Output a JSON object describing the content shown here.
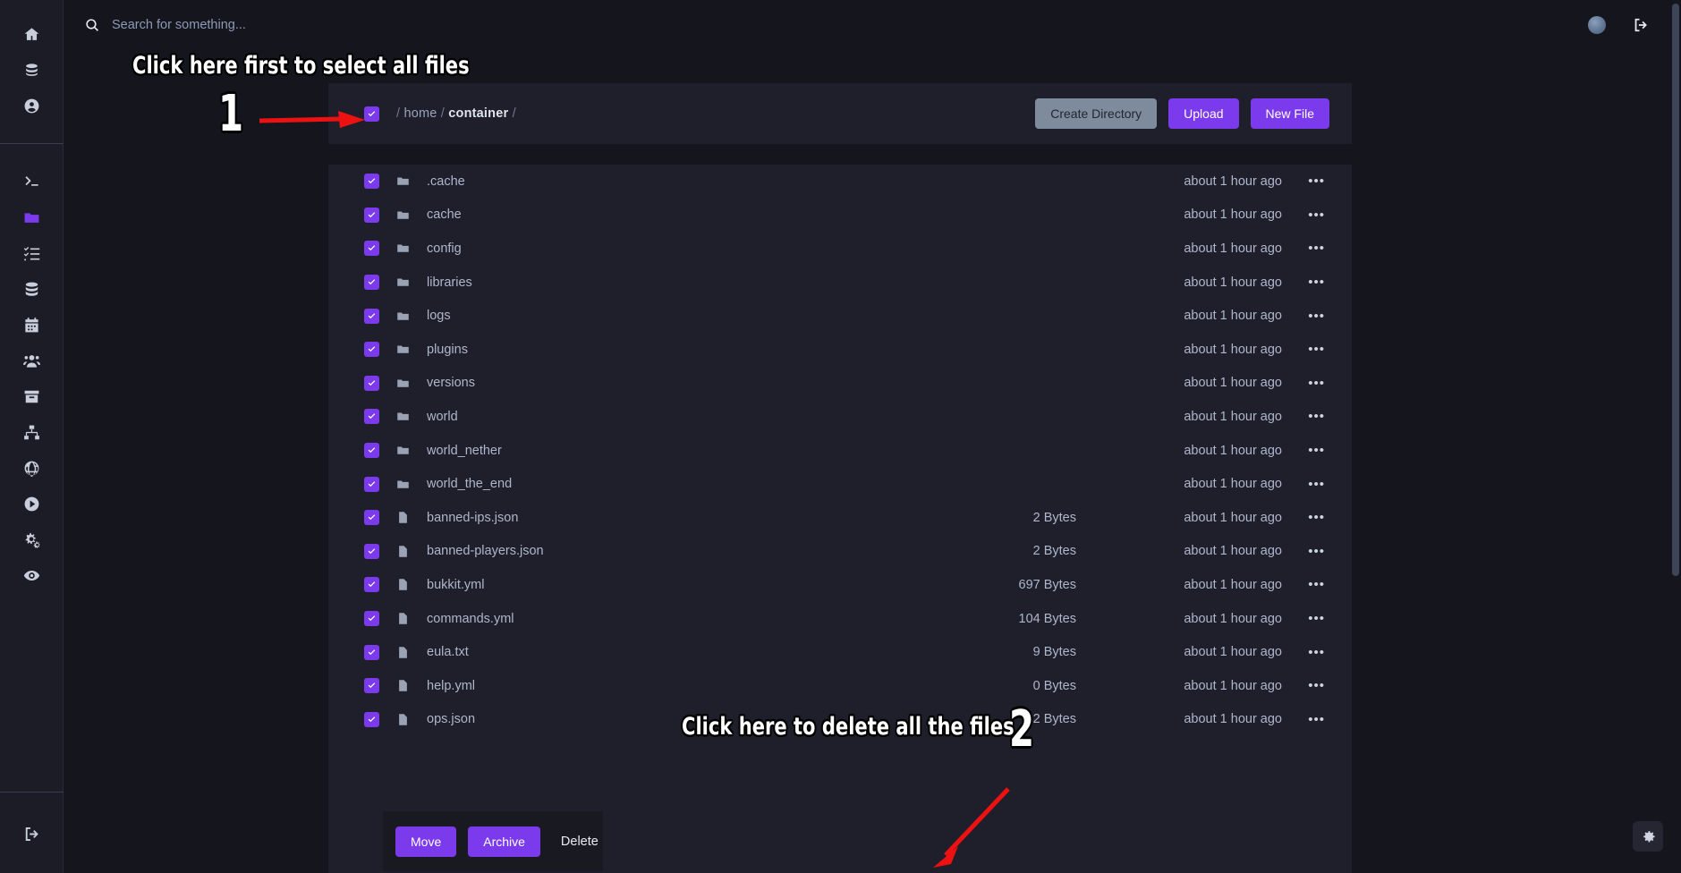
{
  "search": {
    "placeholder": "Search for something...",
    "value": "",
    "icon": "search-icon"
  },
  "topbar": {
    "avatar": "avatar",
    "logout_icon": "logout-icon"
  },
  "sidebar": {
    "top_items": [
      {
        "name": "home",
        "icon": "home-icon"
      },
      {
        "name": "billing",
        "icon": "coins-icon"
      },
      {
        "name": "account",
        "icon": "user-circle-icon"
      }
    ],
    "mid_items": [
      {
        "name": "console",
        "icon": "terminal-icon",
        "active": false
      },
      {
        "name": "files",
        "icon": "folder-icon",
        "active": true
      },
      {
        "name": "tasks",
        "icon": "task-list-icon",
        "active": false
      },
      {
        "name": "databases",
        "icon": "database-icon",
        "active": false
      },
      {
        "name": "schedules",
        "icon": "calendar-icon",
        "active": false
      },
      {
        "name": "users",
        "icon": "users-icon",
        "active": false
      },
      {
        "name": "backups",
        "icon": "archive-box-icon",
        "active": false
      },
      {
        "name": "network",
        "icon": "sitemap-icon",
        "active": false
      },
      {
        "name": "domains",
        "icon": "globe-icon",
        "active": false
      },
      {
        "name": "startup",
        "icon": "play-circle-icon",
        "active": false
      },
      {
        "name": "settings",
        "icon": "gears-icon",
        "active": false
      },
      {
        "name": "activity",
        "icon": "eye-icon",
        "active": false
      }
    ],
    "bottom_items": [
      {
        "name": "logout",
        "icon": "logout-icon"
      }
    ]
  },
  "breadcrumb": {
    "select_all_checked": true,
    "parts": [
      {
        "text": "/",
        "type": "sep"
      },
      {
        "text": "home",
        "type": "crumb"
      },
      {
        "text": "/",
        "type": "sep"
      },
      {
        "text": "container",
        "type": "crumb-current"
      },
      {
        "text": "/",
        "type": "sep"
      }
    ]
  },
  "header_buttons": [
    {
      "label": "Create Directory",
      "style": "grey",
      "name": "create-directory-button"
    },
    {
      "label": "Upload",
      "style": "purple",
      "name": "upload-button"
    },
    {
      "label": "New File",
      "style": "purple",
      "name": "new-file-button"
    }
  ],
  "files": [
    {
      "name": ".cache",
      "type": "folder",
      "size": "",
      "modified": "about 1 hour ago",
      "checked": true
    },
    {
      "name": "cache",
      "type": "folder",
      "size": "",
      "modified": "about 1 hour ago",
      "checked": true
    },
    {
      "name": "config",
      "type": "folder",
      "size": "",
      "modified": "about 1 hour ago",
      "checked": true
    },
    {
      "name": "libraries",
      "type": "folder",
      "size": "",
      "modified": "about 1 hour ago",
      "checked": true
    },
    {
      "name": "logs",
      "type": "folder",
      "size": "",
      "modified": "about 1 hour ago",
      "checked": true
    },
    {
      "name": "plugins",
      "type": "folder",
      "size": "",
      "modified": "about 1 hour ago",
      "checked": true
    },
    {
      "name": "versions",
      "type": "folder",
      "size": "",
      "modified": "about 1 hour ago",
      "checked": true
    },
    {
      "name": "world",
      "type": "folder",
      "size": "",
      "modified": "about 1 hour ago",
      "checked": true
    },
    {
      "name": "world_nether",
      "type": "folder",
      "size": "",
      "modified": "about 1 hour ago",
      "checked": true
    },
    {
      "name": "world_the_end",
      "type": "folder",
      "size": "",
      "modified": "about 1 hour ago",
      "checked": true
    },
    {
      "name": "banned-ips.json",
      "type": "file",
      "size": "2 Bytes",
      "modified": "about 1 hour ago",
      "checked": true
    },
    {
      "name": "banned-players.json",
      "type": "file",
      "size": "2 Bytes",
      "modified": "about 1 hour ago",
      "checked": true
    },
    {
      "name": "bukkit.yml",
      "type": "file",
      "size": "697 Bytes",
      "modified": "about 1 hour ago",
      "checked": true
    },
    {
      "name": "commands.yml",
      "type": "file",
      "size": "104 Bytes",
      "modified": "about 1 hour ago",
      "checked": true
    },
    {
      "name": "eula.txt",
      "type": "file",
      "size": "9 Bytes",
      "modified": "about 1 hour ago",
      "checked": true
    },
    {
      "name": "help.yml",
      "type": "file",
      "size": "0 Bytes",
      "modified": "about 1 hour ago",
      "checked": true
    },
    {
      "name": "ops.json",
      "type": "file",
      "size": "2 Bytes",
      "modified": "about 1 hour ago",
      "checked": true
    }
  ],
  "row_menu_glyph": "•••",
  "action_bar": [
    {
      "label": "Move",
      "style": "purple",
      "name": "move-button"
    },
    {
      "label": "Archive",
      "style": "purple",
      "name": "archive-button"
    },
    {
      "label": "Delete",
      "style": "text",
      "name": "delete-button"
    }
  ],
  "annotations": {
    "step1_text": "Click here first to select all files",
    "step1_number": "1",
    "step2_text": "Click here to delete all the files",
    "step2_number": "2",
    "arrow_color": "#ee1111"
  },
  "fab": {
    "icon": "gear-icon",
    "name": "settings-fab"
  },
  "colors": {
    "accent": "#7c3aed",
    "page_bg": "#15151e",
    "panel_bg": "#1f1f2b",
    "sidebar_bg": "#1c1c27",
    "grey_button": "#7e8b9c",
    "text_muted": "#aeb6cc"
  }
}
